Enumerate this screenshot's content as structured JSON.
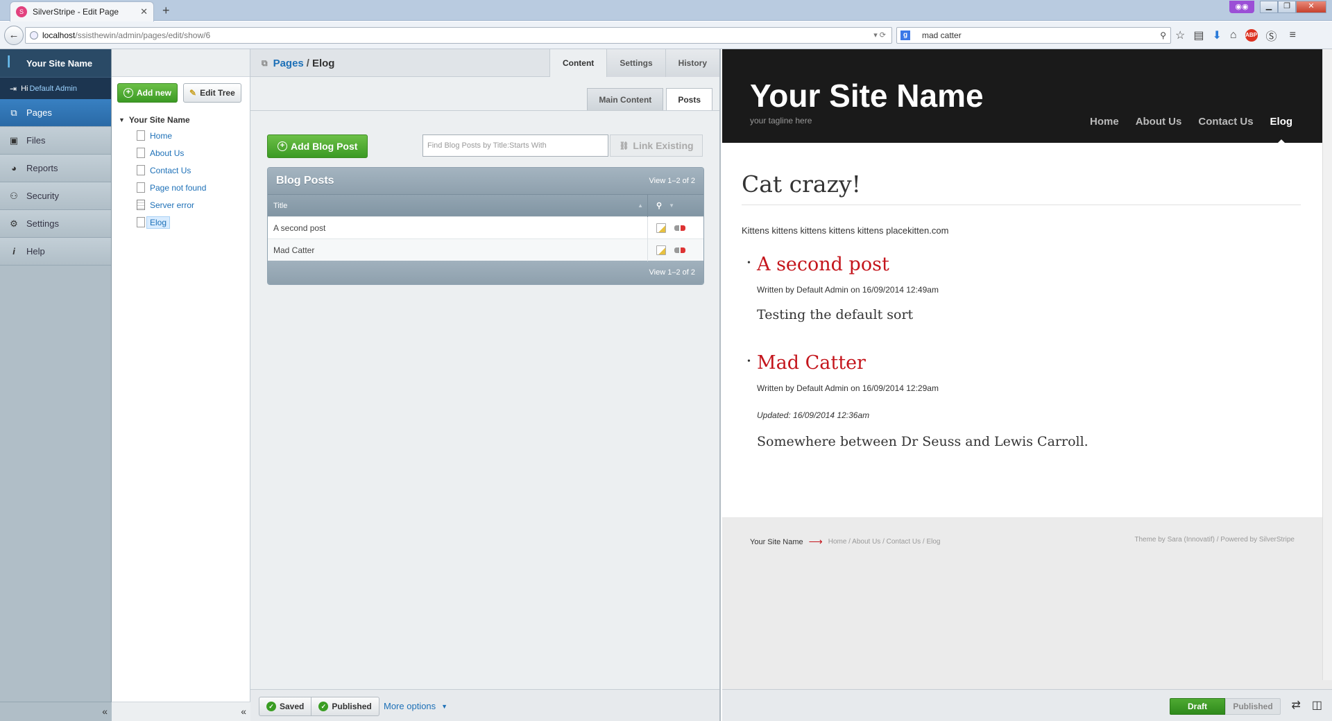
{
  "browser": {
    "tab_title": "SilverStripe - Edit Page",
    "tab_close": "✕",
    "new_tab": "+",
    "url_host": "localhost",
    "url_path": "/ssisthewin/admin/pages/edit/show/6",
    "search_value": "mad catter"
  },
  "menu": {
    "site_name": "Your Site Name",
    "greeting": "Hi",
    "user": "Default Admin",
    "items": [
      {
        "label": "Pages",
        "icon": "sitemap-icon"
      },
      {
        "label": "Files",
        "icon": "image-icon"
      },
      {
        "label": "Reports",
        "icon": "pie-chart-icon"
      },
      {
        "label": "Security",
        "icon": "users-icon"
      },
      {
        "label": "Settings",
        "icon": "gear-icon"
      },
      {
        "label": "Help",
        "icon": "info-icon"
      }
    ],
    "collapse": "«"
  },
  "tree": {
    "add_new": "Add new",
    "edit_tree": "Edit Tree",
    "root": "Your Site Name",
    "nodes": [
      "Home",
      "About Us",
      "Contact Us",
      "Page not found",
      "Server error",
      "Elog"
    ],
    "collapse": "«"
  },
  "edit": {
    "breadcrumb_parent": "Pages",
    "breadcrumb_sep": "/",
    "breadcrumb_current": "Elog",
    "tabs": [
      "Content",
      "Settings",
      "History"
    ],
    "subtabs": [
      "Main Content",
      "Posts"
    ],
    "add_blog_post": "Add Blog Post",
    "find_placeholder": "Find Blog Posts by Title:Starts With",
    "link_existing": "Link Existing",
    "grid_title": "Blog Posts",
    "grid_count": "View 1–2 of 2",
    "col_title": "Title",
    "rows": [
      "A second post",
      "Mad Catter"
    ],
    "grid_footer": "View 1–2 of 2",
    "saved": "Saved",
    "published": "Published",
    "more_options": "More options"
  },
  "preview": {
    "site_name": "Your Site Name",
    "tagline": "your tagline here",
    "nav": [
      "Home",
      "About Us",
      "Contact Us",
      "Elog"
    ],
    "page_title": "Cat crazy!",
    "intro": "Kittens kittens kittens kittens kittens placekitten.com",
    "posts": [
      {
        "title": "A second post",
        "meta": "Written by Default Admin on 16/09/2014 12:49am",
        "updated": "",
        "summary": "Testing the default sort"
      },
      {
        "title": "Mad Catter",
        "meta": "Written by Default Admin on 16/09/2014 12:29am",
        "updated": "Updated: 16/09/2014 12:36am",
        "summary": "Somewhere between Dr Seuss and Lewis Carroll."
      }
    ],
    "footer_site": "Your Site Name",
    "footer_crumbs": "Home / About Us / Contact Us / Elog",
    "footer_credit": "Theme by Sara (Innovatif) / Powered by SilverStripe",
    "mode_draft": "Draft",
    "mode_published": "Published"
  },
  "colors": {
    "accent": "#2a6aa6",
    "green": "#3b9a24",
    "post_title": "#c4151c"
  }
}
